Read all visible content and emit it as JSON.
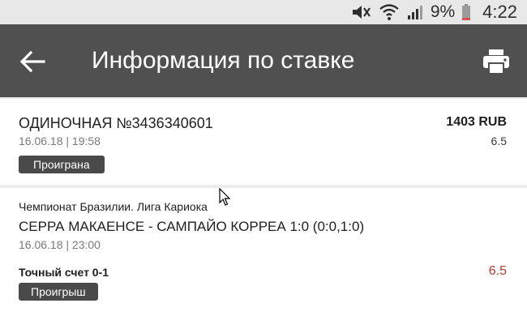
{
  "status_bar": {
    "battery": "9%",
    "time": "4:22",
    "icons": [
      "mute-icon",
      "wifi-icon",
      "signal-icon",
      "battery-icon"
    ]
  },
  "app_bar": {
    "title": "Информация по ставке",
    "back_icon": "arrow-left-icon",
    "print_icon": "printer-icon"
  },
  "bet": {
    "title": "ОДИНОЧНАЯ №3436340601",
    "date": "16.06.18 | 19:58",
    "amount": "1403 RUB",
    "odds": "6.5",
    "status": "Проиграна"
  },
  "event": {
    "league": "Чемпионат Бразилии. Лига Кариока",
    "match": "СЕРРА МАКАЕНСЕ - САМПАЙО КОРРЕА 1:0 (0:0,1:0)",
    "date": "16.06.18 | 23:00",
    "outcome": "Точный счет 0-1",
    "odds": "6.5",
    "result": "Проигрыш"
  },
  "colors": {
    "app_bar": "#505050",
    "badge": "#4a4a4a",
    "odds_loss": "#c0392b"
  }
}
